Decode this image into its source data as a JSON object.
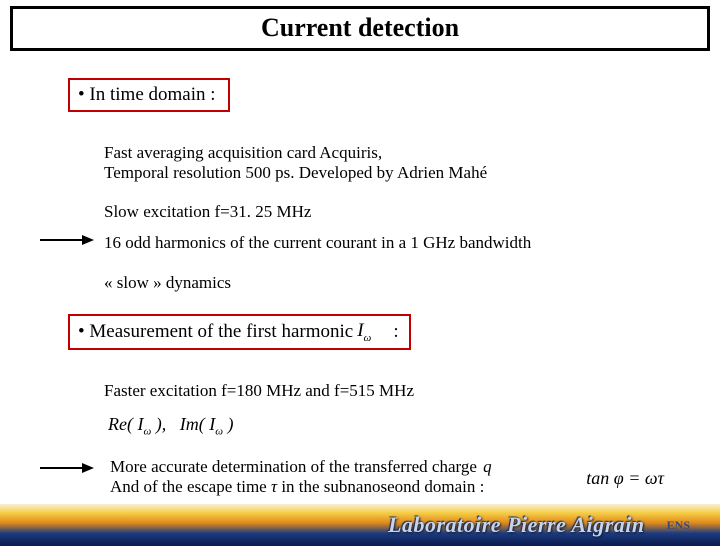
{
  "title": "Current detection",
  "bullet1": "• In time domain :",
  "lines": {
    "l1": "Fast averaging acquisition card Acquiris,",
    "l2": "Temporal resolution 500 ps.    Developed by Adrien Mahé",
    "l3": "Slow excitation f=31. 25 MHz",
    "l4": "16 odd harmonics of the current courant in a 1 GHz bandwidth",
    "l5": "« slow » dynamics",
    "l6": "Faster excitation f=180 MHz and f=515 MHz",
    "l7": "More accurate determination of the transferred charge",
    "l8a": "And of the escape time ",
    "l8b": " in the subnanoseond domain : "
  },
  "bullet2_prefix": "• Measurement of the first harmonic ",
  "bullet2_symbol_html": "I<sub>ω</sub>",
  "bullet2_suffix": ":",
  "reim_html": "Re( I<sub>ω</sub> ),   Im( I<sub>ω</sub> )",
  "q_symbol": "q",
  "tau_symbol": "τ",
  "tan_html": "tan φ = ωτ",
  "footer": {
    "lab": "Laboratoire Pierre Aigrain",
    "ens": "ENS"
  }
}
